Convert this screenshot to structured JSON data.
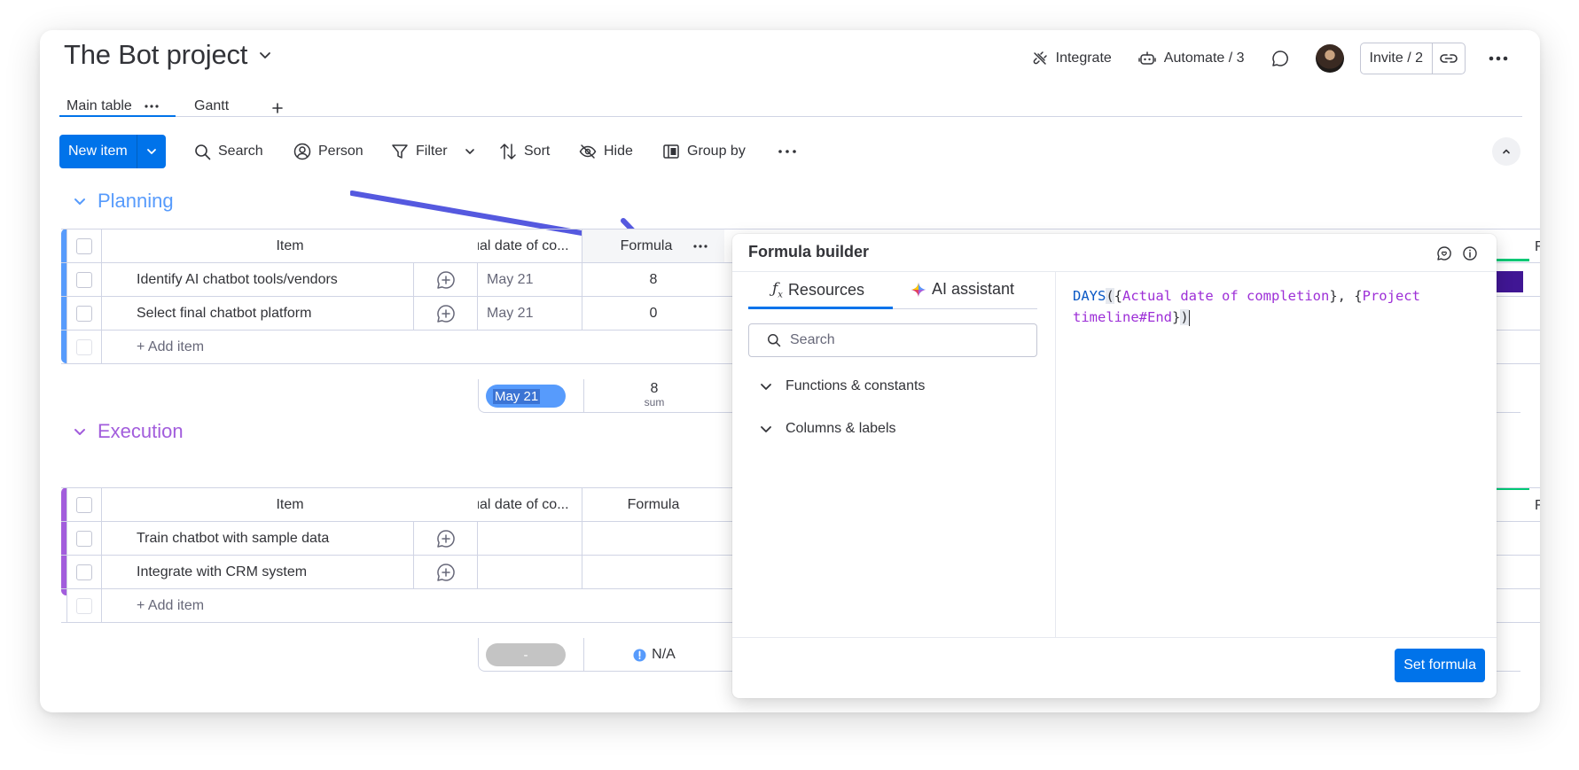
{
  "header": {
    "title": "The Bot project",
    "integrate": "Integrate",
    "automate": "Automate / 3",
    "invite": "Invite / 2"
  },
  "tabs": [
    {
      "label": "Main table",
      "active": true
    },
    {
      "label": "Gantt",
      "active": false
    }
  ],
  "toolbar": {
    "new_item": "New item",
    "search": "Search",
    "person": "Person",
    "filter": "Filter",
    "sort": "Sort",
    "hide": "Hide",
    "group_by": "Group by"
  },
  "groups": [
    {
      "name": "Planning",
      "color": "#579bfc",
      "columns": {
        "item": "Item",
        "actual": "Actual date of co...",
        "formula": "Formula"
      },
      "rows": [
        {
          "item": "Identify AI chatbot tools/vendors",
          "actual": "May 21",
          "formula": "8"
        },
        {
          "item": "Select final chatbot platform",
          "actual": "May 21",
          "formula": "0"
        }
      ],
      "add_item": "+ Add item",
      "summary": {
        "date": "May 21",
        "formula": "8",
        "formula_label": "sum"
      }
    },
    {
      "name": "Execution",
      "color": "#a25ddc",
      "columns": {
        "item": "Item",
        "actual": "Actual date of co...",
        "formula": "Formula"
      },
      "rows": [
        {
          "item": "Train chatbot with sample data",
          "actual": "",
          "formula": ""
        },
        {
          "item": "Integrate with CRM system",
          "actual": "",
          "formula": ""
        }
      ],
      "add_item": "+ Add item",
      "summary": {
        "date": "-",
        "formula": "N/A"
      }
    }
  ],
  "formula_builder": {
    "title": "Formula builder",
    "tab_resources": "Resources",
    "tab_ai": "AI assistant",
    "search_placeholder": "Search",
    "sections": [
      "Functions & constants",
      "Columns & labels"
    ],
    "formula": {
      "fn": "DAYS",
      "arg1": "Actual date of completion",
      "arg2_line1": "Project",
      "arg2_line2": "timeline#End"
    },
    "set_button": "Set formula"
  },
  "colors": {
    "accent": "#0073ea",
    "planning": "#579bfc",
    "execution": "#a25ddc",
    "arrow": "#5559df"
  }
}
